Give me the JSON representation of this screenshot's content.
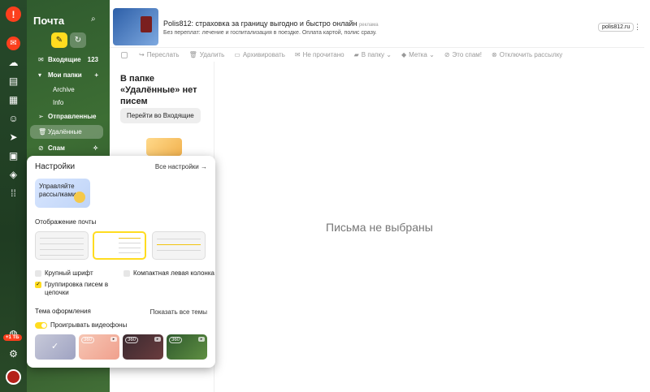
{
  "sidebar": {
    "title": "Почта",
    "folders": [
      {
        "label": "Входящие",
        "count": "123"
      },
      {
        "label": "Мои папки"
      },
      {
        "label": "Archive"
      },
      {
        "label": "Info"
      },
      {
        "label": "Отправленные"
      },
      {
        "label": "Удалённые"
      },
      {
        "label": "Спам"
      }
    ]
  },
  "rail": {
    "badge": "+1 ТБ"
  },
  "ad": {
    "title": "Polis812: страховка за границу выгодно и быстро онлайн",
    "tag": "реклама",
    "subtitle": "Без переплат: лечение и госпитализация в поездке. Оплата картой, полис сразу.",
    "button": "polis812.ru",
    "more": "⋮"
  },
  "toolbar": {
    "items": [
      "Переслать",
      "Удалить",
      "Архивировать",
      "Не прочитано",
      "В папку",
      "Метка",
      "Это спам!",
      "Отключить рассылку"
    ]
  },
  "list": {
    "empty_title": "В папке «Удалённые» нет писем",
    "goto_button": "Перейти во Входящие"
  },
  "preview": {
    "empty_text": "Письма не выбраны"
  },
  "settings": {
    "title": "Настройки",
    "all_settings": "Все настройки →",
    "promo": "Управляйте рассылками",
    "display_label": "Отображение почты",
    "large_font": "Крупный шрифт",
    "compact_column": "Компактная левая колонка",
    "grouping": "Группировка писем в цепочки",
    "theme_label": "Тема оформления",
    "show_all_themes": "Показать все темы",
    "video_bg": "Проигрывать видеофоны",
    "theme_tag": "360"
  },
  "colors": {
    "accent": "#ffdc1f",
    "brand": "#fc3f1d"
  }
}
